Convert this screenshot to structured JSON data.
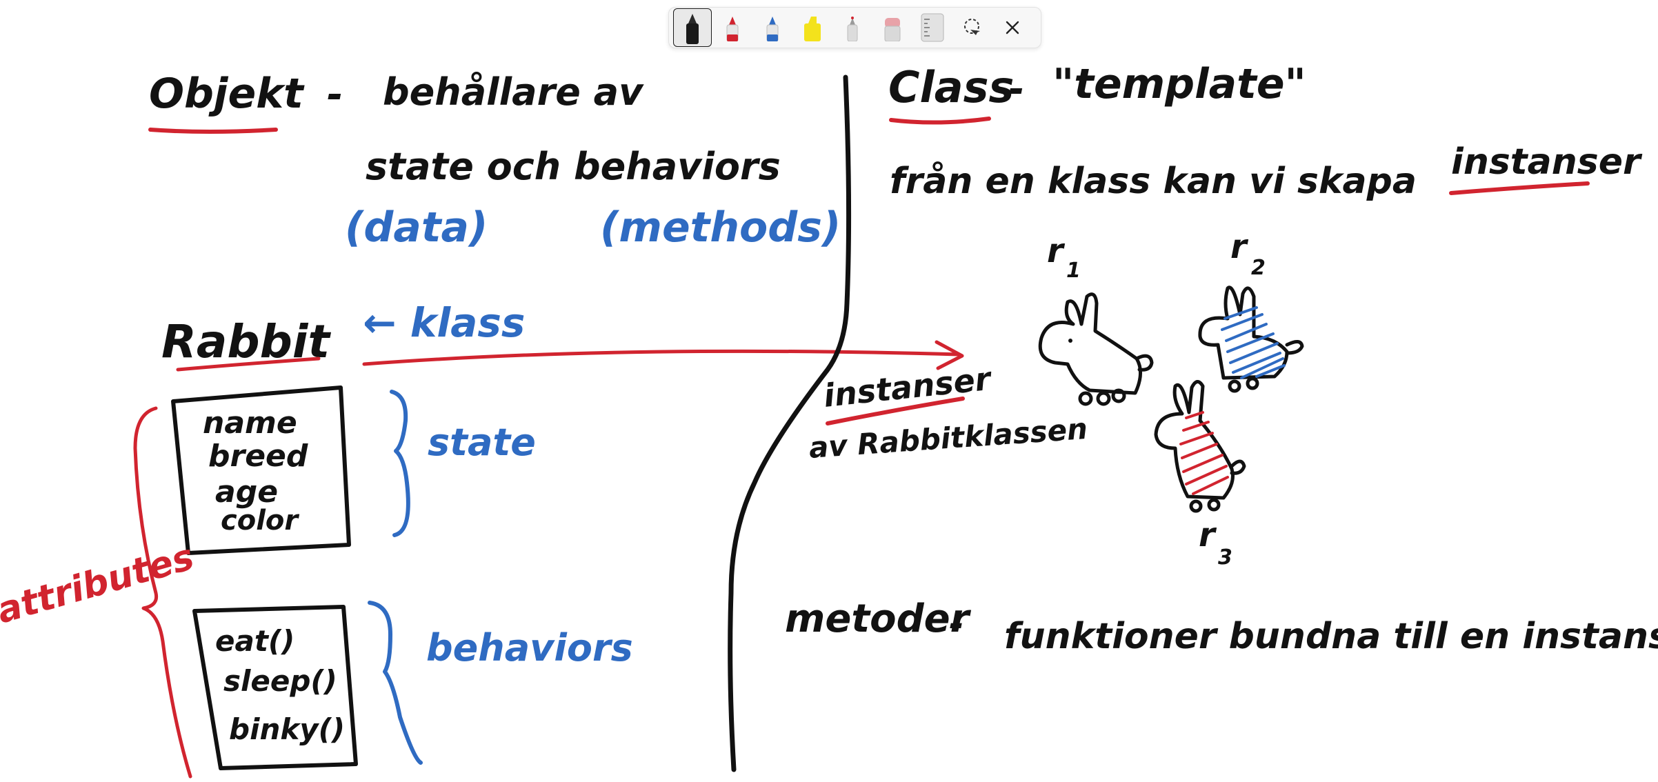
{
  "toolbar": {
    "tools": [
      {
        "name": "pen-black",
        "color": "#1a1a1a",
        "active": true
      },
      {
        "name": "pen-red",
        "color": "#d1242f",
        "active": false
      },
      {
        "name": "pen-blue",
        "color": "#2f6bc2",
        "active": false
      },
      {
        "name": "highlighter-yellow",
        "color": "#f3e21c",
        "active": false
      },
      {
        "name": "pencil",
        "color": "#c8c8c8",
        "active": false
      },
      {
        "name": "eraser",
        "color": "#e8a2a8",
        "active": false
      },
      {
        "name": "ruler",
        "color": "#cfcfcf",
        "active": false
      },
      {
        "name": "lasso-select",
        "active": false
      },
      {
        "name": "close",
        "active": false
      }
    ]
  },
  "notes": {
    "left": {
      "objekt": "Objekt",
      "dash1": "-",
      "line1": "behållare av",
      "line2": "state och behaviors",
      "data_paren": "(data)",
      "methods_paren": "(methods)",
      "rabbit": "Rabbit",
      "klass_arrow": "← klass",
      "state_fields": [
        "name",
        "breed",
        "age",
        "color"
      ],
      "state_label": "state",
      "behavior_fields": [
        "eat()",
        "sleep()",
        "binky()"
      ],
      "behaviors_label": "behaviors",
      "attributes_label": "attributes"
    },
    "right": {
      "class": "Class",
      "dash2": "-",
      "template": "\"template\"",
      "line_instanser": "från en klass kan vi skapa",
      "instanser_word": "instanser",
      "r1": "r",
      "r1_sub": "1",
      "r2": "r",
      "r2_sub": "2",
      "r3": "r",
      "r3_sub": "3",
      "instanser_label": "instanser",
      "av_rabbitklassen": "av Rabbitklassen",
      "metoder": "metoder",
      "dash3": "-",
      "metoder_def": "funktioner bundna till en instans"
    }
  },
  "colors": {
    "ink_black": "#111111",
    "ink_red": "#d1242f",
    "ink_blue": "#2f6bc2",
    "background": "#ffffff"
  }
}
